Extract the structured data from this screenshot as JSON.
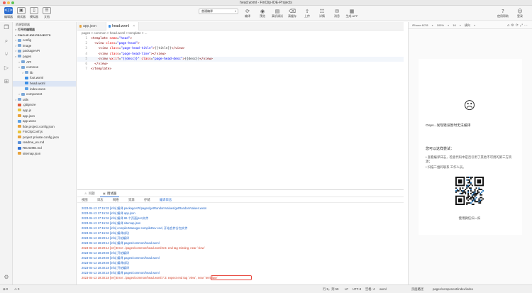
{
  "window": {
    "title": "head.wxml - FinClip-IDE-Projects"
  },
  "toolbar": {
    "left": [
      {
        "label": "编辑器",
        "icon": "code-icon",
        "glyph": "</>"
      },
      {
        "label": "调试器",
        "icon": "debug-icon",
        "glyph": "▣"
      },
      {
        "label": "模拟器",
        "icon": "phone-icon",
        "glyph": "▯"
      },
      {
        "label": "文档",
        "icon": "doc-icon",
        "glyph": "☰"
      }
    ],
    "compile_mode": "普通编译",
    "center": [
      {
        "label": "编译",
        "icon": "compile-icon",
        "glyph": "⟳"
      },
      {
        "label": "预览",
        "icon": "preview-icon",
        "glyph": "◉"
      },
      {
        "label": "真机调试",
        "icon": "device-debug-icon",
        "glyph": "▤"
      },
      {
        "label": "清缓存",
        "icon": "clear-cache-icon",
        "glyph": "⌫"
      },
      {
        "label": "上传",
        "icon": "upload-icon",
        "glyph": "⇪"
      },
      {
        "label": "详情",
        "icon": "details-icon",
        "glyph": "☷"
      },
      {
        "label": "消息",
        "icon": "message-icon",
        "glyph": "✉"
      },
      {
        "label": "生成 APP",
        "icon": "build-app-icon",
        "glyph": "▦"
      }
    ],
    "right": [
      {
        "label": "使用帮助",
        "icon": "help-icon",
        "glyph": "?"
      },
      {
        "label": "登录",
        "icon": "user-icon",
        "glyph": "☺"
      }
    ]
  },
  "explorer": {
    "title": "资源管理器",
    "sections": {
      "open_editors": "打开的编辑器",
      "project": "FINCLIP-IDE-PROJECTS"
    },
    "items": [
      {
        "label": "config",
        "type": "folder",
        "depth": 1,
        "arrow": ">"
      },
      {
        "label": "image",
        "type": "folder",
        "depth": 1,
        "arrow": ">"
      },
      {
        "label": "packageAPI",
        "type": "folder",
        "depth": 1,
        "arrow": ">"
      },
      {
        "label": "pages",
        "type": "folder",
        "depth": 1,
        "arrow": "v"
      },
      {
        "label": "API",
        "type": "folder",
        "depth": 2,
        "arrow": ">"
      },
      {
        "label": "common",
        "type": "folder",
        "depth": 2,
        "arrow": "v"
      },
      {
        "label": "lib",
        "type": "folder",
        "depth": 3,
        "arrow": ">"
      },
      {
        "label": "foot.wxml",
        "type": "wxml",
        "depth": 3,
        "arrow": ""
      },
      {
        "label": "head.wxml",
        "type": "wxml",
        "depth": 3,
        "arrow": "",
        "selected": true
      },
      {
        "label": "index.wxss",
        "type": "wxss",
        "depth": 3,
        "arrow": ""
      },
      {
        "label": "component",
        "type": "folder",
        "depth": 2,
        "arrow": ">"
      },
      {
        "label": "utils",
        "type": "folder",
        "depth": 1,
        "arrow": ">"
      },
      {
        "label": ".gitignore",
        "type": "git",
        "depth": 1,
        "arrow": ""
      },
      {
        "label": "app.js",
        "type": "js",
        "depth": 1,
        "arrow": ""
      },
      {
        "label": "app.json",
        "type": "json",
        "depth": 1,
        "arrow": ""
      },
      {
        "label": "app.wxss",
        "type": "wxss",
        "depth": 1,
        "arrow": ""
      },
      {
        "label": "fide.project.config.json",
        "type": "json",
        "depth": 1,
        "arrow": ""
      },
      {
        "label": "FinClipConf.js",
        "type": "js",
        "depth": 1,
        "arrow": ""
      },
      {
        "label": "project.private.config.json",
        "type": "json",
        "depth": 1,
        "arrow": ""
      },
      {
        "label": "readme_en.md",
        "type": "md",
        "depth": 1,
        "arrow": ""
      },
      {
        "label": "README.md",
        "type": "info",
        "depth": 1,
        "arrow": ""
      },
      {
        "label": "sitemap.json",
        "type": "json",
        "depth": 1,
        "arrow": ""
      }
    ]
  },
  "editor": {
    "tabs": [
      {
        "label": "app.json",
        "active": false
      },
      {
        "label": "head.wxml",
        "active": true,
        "close": "×"
      }
    ],
    "breadcrumb": "pages > common > head.wxml > template > ...",
    "lines": [
      {
        "n": "1",
        "t": "<template name=\"head\">"
      },
      {
        "n": "2",
        "t": "  <view class=\"page-head\">"
      },
      {
        "n": "3",
        "t": "    <view class=\"page-head-title\">{{title}}</view>"
      },
      {
        "n": "4",
        "t": "    <view class=\"page-head-line\"></view>"
      },
      {
        "n": "5",
        "t": "    <view wx:if=\"{{desc}}\" class=\"page-head-desc\">{{desc}}</view>"
      },
      {
        "n": "6",
        "t": "  </view>"
      },
      {
        "n": "7",
        "t": "</template>"
      }
    ]
  },
  "panel": {
    "tabs": [
      {
        "label": "问题",
        "icon": "problems-icon",
        "glyph": "⚠"
      },
      {
        "label": "调试器",
        "icon": "debugger-icon",
        "glyph": "▣"
      }
    ],
    "subtabs": [
      "视图",
      "日志",
      "网络",
      "资源",
      "存储",
      "编译日志"
    ],
    "logs": [
      {
        "text": "2023-04-13 17:15:32 [info] 编译 packageAPI/pages/getRandomValues/getRandomValues.wxss",
        "type": "info"
      },
      {
        "text": "2023-04-13 17:15:34 [info] 编译 app.json",
        "type": "info"
      },
      {
        "text": "2023-04-13 17:15:34 [info] 编译 86 个页面json文件",
        "type": "info"
      },
      {
        "text": "2023-04-13 17:15:34 [info] 编译 sitemap.json",
        "type": "info"
      },
      {
        "text": "2023-04-13 17:15:34 [info] compilerManager.compileDev end, 开始合并分包文件",
        "type": "info"
      },
      {
        "text": "2023-04-13 17:15:34 [info] 编译成功",
        "type": "info"
      },
      {
        "text": "2023-04-13 19:29:14 [info] 开始编译",
        "type": "info"
      },
      {
        "text": "2023-04-13 19:29:14 [info] 编译 pages/common/head.wxml",
        "type": "info"
      },
      {
        "text": "2023-04-13 19:29:14 [err] Error: ./pages/common/head.wxml:5:6: end tag missing, near `view`",
        "type": "err"
      },
      {
        "text": "2023-04-13 19:29:59 [info] 开始编译",
        "type": "info"
      },
      {
        "text": "2023-04-13 19:29:59 [info] 编译 pages/common/head.wxml",
        "type": "info"
      },
      {
        "text": "2023-04-13 19:29:59 [info] 编译成功",
        "type": "info"
      },
      {
        "text": "2023-04-13 19:30:18 [info] 开始编译",
        "type": "info"
      },
      {
        "text": "2023-04-13 19:30:18 [info] 编译 pages/common/head.wxml",
        "type": "info"
      },
      {
        "text": "2023-04-13 19:30:18 [err] Error: ./pages/common/head.wxml:7:3: expect end tag `view`, near `template`",
        "type": "err"
      }
    ]
  },
  "preview": {
    "device": "iPhone 6/7/8",
    "zoom": "100%",
    "network": "16",
    "mode": "横向",
    "sad_face": "☹",
    "message": "Oops...发现错误暂时无法编译",
    "try_title": "您可以这样尝试：",
    "tips": [
      "查看编译日志，检查代码中是否引用了其他不可用的第三方资源；",
      "扫描二维码联系 工作人员。"
    ],
    "scan_label": "使用微信扫一扫"
  },
  "statusbar": {
    "errors": "⊗ 0",
    "warnings": "⚠ 0",
    "cursor": "行 5，列 59",
    "eol": "LF",
    "encoding": "UTF-8",
    "indent": "空格: 4",
    "language": "wxml",
    "page_path_label": "页面路径",
    "page_path": "pages/component/index/index"
  },
  "colors": {
    "accent": "#2f6fd1",
    "error": "#d2412a",
    "info_log": "#1e63c9",
    "highlight_box": "#e8453c"
  }
}
